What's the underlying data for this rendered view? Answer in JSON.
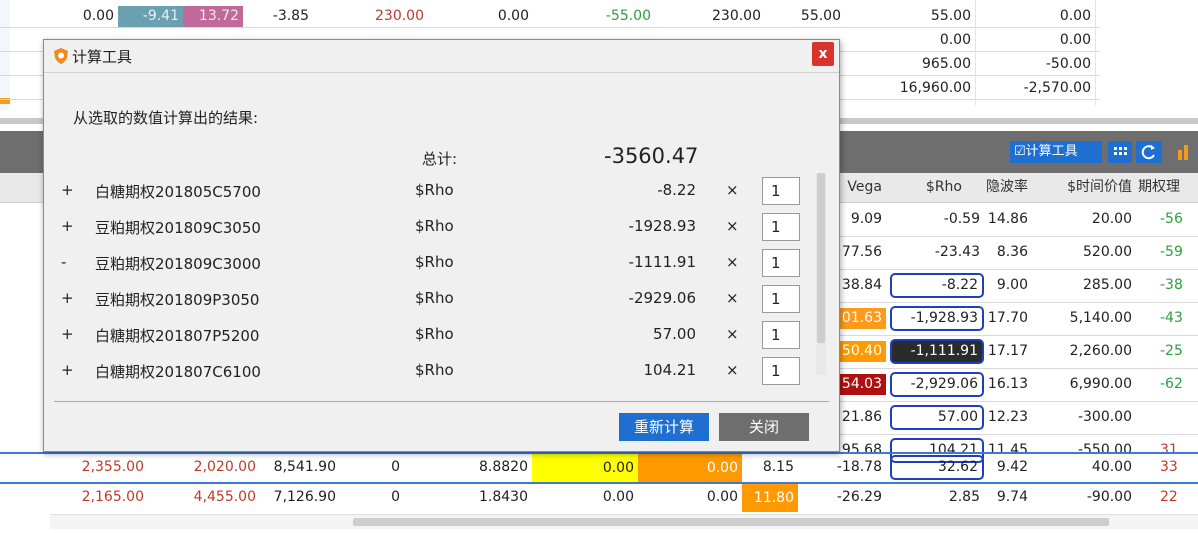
{
  "top_rows": [
    [
      "0.00",
      "-9.41",
      "13.72",
      "-3.85",
      "230.00",
      "0.00",
      "-55.00",
      "230.00",
      "55.00",
      "55.00",
      "0.00"
    ],
    [
      "",
      "",
      "",
      "",
      "",
      "",
      "",
      "",
      "",
      "0.00",
      "0.00"
    ],
    [
      "",
      "",
      "",
      "",
      "",
      "",
      "",
      "",
      "",
      "965.00",
      "-50.00"
    ],
    [
      "",
      "",
      "",
      "",
      "",
      "",
      "",
      "",
      "",
      "16,960.00",
      "-2,570.00"
    ]
  ],
  "toolbar": {
    "calc_tool_label": "计算工具",
    "checkbox_glyph": "☑",
    "grid_icon": "grid-icon",
    "refresh_icon": "refresh-icon",
    "chart_icon": "chart-icon"
  },
  "columns": {
    "vega": "Vega",
    "rho": "$Rho",
    "implied_vol": "隐波率",
    "time_value": "$时间价值",
    "theoretical": "期权理"
  },
  "right_rows": [
    {
      "vega": "9.09",
      "rho": "-0.59",
      "iv": "14.86",
      "tv": "20.00",
      "th": "-56"
    },
    {
      "vega": "77.56",
      "rho": "-23.43",
      "iv": "8.36",
      "tv": "520.00",
      "th": "-59"
    },
    {
      "vega": "38.84",
      "rho": "-8.22",
      "iv": "9.00",
      "tv": "285.00",
      "th": "-38"
    },
    {
      "vega": "01.63",
      "rho": "-1,928.93",
      "iv": "17.70",
      "tv": "5,140.00",
      "th": "-43"
    },
    {
      "vega": "50.40",
      "rho": "-1,111.91",
      "iv": "17.17",
      "tv": "2,260.00",
      "th": "-25"
    },
    {
      "vega": "54.03",
      "rho": "-2,929.06",
      "iv": "16.13",
      "tv": "6,990.00",
      "th": "-62"
    },
    {
      "vega": "21.86",
      "rho": "57.00",
      "iv": "12.23",
      "tv": "-300.00",
      "th": ""
    },
    {
      "vega": "95.68",
      "rho": "104.21",
      "iv": "11.45",
      "tv": "-550.00",
      "th": "31"
    }
  ],
  "bottom_rows": [
    {
      "c1": "2,355.00",
      "c2": "2,020.00",
      "c3": "8,541.90",
      "c4": "0",
      "c5": "8.8820",
      "c6": "0.00",
      "c7": "0.00",
      "c8": "8.15",
      "vega": "-18.78",
      "rho": "32.62",
      "iv": "9.42",
      "tv": "40.00",
      "th": "33"
    },
    {
      "c1": "2,165.00",
      "c2": "4,455.00",
      "c3": "7,126.90",
      "c4": "0",
      "c5": "1.8430",
      "c6": "0.00",
      "c7": "0.00",
      "c8": "11.80",
      "vega": "-26.29",
      "rho": "2.85",
      "iv": "9.74",
      "tv": "-90.00",
      "th": "22"
    }
  ],
  "dialog": {
    "title": "计算工具",
    "close_label": "x",
    "subtitle": "从选取的数值计算出的结果:",
    "total_label": "总计:",
    "total_value": "-3560.47",
    "items": [
      {
        "sign": "+",
        "name": "白糖期权201805C5700",
        "field": "$Rho",
        "value": "-8.22",
        "mult": "1"
      },
      {
        "sign": "+",
        "name": "豆粕期权201809C3050",
        "field": "$Rho",
        "value": "-1928.93",
        "mult": "1"
      },
      {
        "sign": "-",
        "name": "豆粕期权201809C3000",
        "field": "$Rho",
        "value": "-1111.91",
        "mult": "1"
      },
      {
        "sign": "+",
        "name": "豆粕期权201809P3050",
        "field": "$Rho",
        "value": "-2929.06",
        "mult": "1"
      },
      {
        "sign": "+",
        "name": "白糖期权201807P5200",
        "field": "$Rho",
        "value": "57.00",
        "mult": "1"
      },
      {
        "sign": "+",
        "name": "白糖期权201807C6100",
        "field": "$Rho",
        "value": "104.21",
        "mult": "1"
      }
    ],
    "times_symbol": "×",
    "recalc_label": "重新计算",
    "close_button_label": "关闭"
  },
  "colors": {
    "accent_blue": "#1f6fd1",
    "close_red": "#d9342b",
    "highlight_yellow": "#ffff00",
    "highlight_orange": "#ff9900",
    "dark_red_cell": "#b01010"
  }
}
